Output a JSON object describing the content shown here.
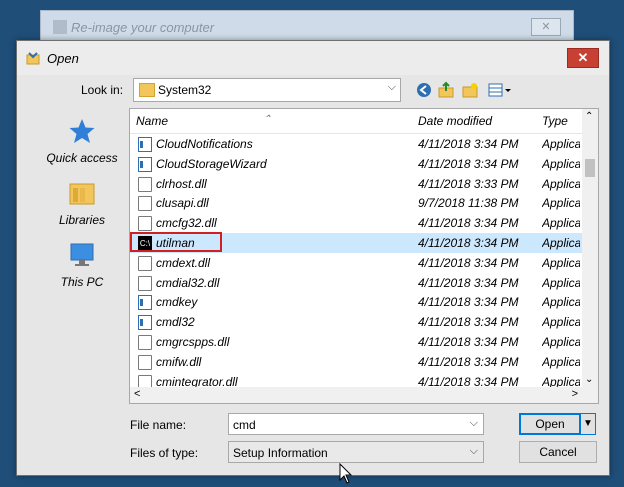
{
  "background_window": {
    "title": "Re-image your computer"
  },
  "dialog": {
    "title": "Open",
    "close_glyph": "✕"
  },
  "toolbar": {
    "look_in_label": "Look in:",
    "look_in_value": "System32",
    "icons": [
      "back-icon",
      "up-folder-icon",
      "new-folder-icon",
      "view-menu-icon"
    ]
  },
  "places": [
    {
      "label": "Quick access",
      "icon": "star-icon"
    },
    {
      "label": "Libraries",
      "icon": "libraries-icon"
    },
    {
      "label": "This PC",
      "icon": "computer-icon"
    }
  ],
  "columns": {
    "name": "Name",
    "date": "Date modified",
    "type": "Type"
  },
  "files": [
    {
      "name": "CloudNotifications",
      "date": "4/11/2018 3:34 PM",
      "type": "Application",
      "icon": "app"
    },
    {
      "name": "CloudStorageWizard",
      "date": "4/11/2018 3:34 PM",
      "type": "Application",
      "icon": "app"
    },
    {
      "name": "clrhost.dll",
      "date": "4/11/2018 3:33 PM",
      "type": "Application",
      "icon": "dll"
    },
    {
      "name": "clusapi.dll",
      "date": "9/7/2018 11:38 PM",
      "type": "Application",
      "icon": "dll"
    },
    {
      "name": "cmcfg32.dll",
      "date": "4/11/2018 3:34 PM",
      "type": "Application",
      "icon": "dll"
    },
    {
      "name": "utilman",
      "date": "4/11/2018 3:34 PM",
      "type": "Application",
      "icon": "cmd",
      "selected": true,
      "renaming": true
    },
    {
      "name": "cmdext.dll",
      "date": "4/11/2018 3:34 PM",
      "type": "Application",
      "icon": "dll"
    },
    {
      "name": "cmdial32.dll",
      "date": "4/11/2018 3:34 PM",
      "type": "Application",
      "icon": "dll"
    },
    {
      "name": "cmdkey",
      "date": "4/11/2018 3:34 PM",
      "type": "Application",
      "icon": "app"
    },
    {
      "name": "cmdl32",
      "date": "4/11/2018 3:34 PM",
      "type": "Application",
      "icon": "app"
    },
    {
      "name": "cmgrcspps.dll",
      "date": "4/11/2018 3:34 PM",
      "type": "Application",
      "icon": "dll"
    },
    {
      "name": "cmifw.dll",
      "date": "4/11/2018 3:34 PM",
      "type": "Application",
      "icon": "dll"
    },
    {
      "name": "cmintegrator.dll",
      "date": "4/11/2018 3:34 PM",
      "type": "Application",
      "icon": "dll"
    }
  ],
  "footer": {
    "file_name_label": "File name:",
    "file_name_value": "cmd",
    "files_of_type_label": "Files of type:",
    "files_of_type_value": "Setup Information",
    "open_label": "Open",
    "cancel_label": "Cancel"
  },
  "colors": {
    "selection": "#cce8ff",
    "highlight_box": "#d02020",
    "close_button": "#c84031",
    "accent": "#0078d7"
  }
}
